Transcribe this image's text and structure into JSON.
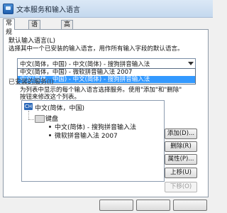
{
  "window": {
    "title": "文本服务和输入语言"
  },
  "tabs": [
    {
      "label": "常规",
      "active": true
    },
    {
      "label": "语言栏",
      "active": false
    },
    {
      "label": "高级键设置",
      "active": false
    }
  ],
  "default_language": {
    "heading": "默认输入语言(L)",
    "description": "选择其中一个已安装的输入语言，用作所有输入字段的默认语言。",
    "selected_value": "中文(简体，中国) - 中文(简体) - 搜狗拼音输入法",
    "options": [
      {
        "label": "中文(简体，中国) - 微软拼音输入法 2007",
        "selected": false
      },
      {
        "label": "中文(简体，中国) - 中文(简体) - 搜狗拼音输入法",
        "selected": true
      }
    ]
  },
  "installed_services": {
    "heading_partial": "已安装的服务(I)",
    "description_line1": "为列表中显示的每个输入语言选择服务。使用\"添加\"和\"删除\"",
    "description_line2": "按钮来修改这个列表。",
    "tree": {
      "language": "中文(简体，中国)",
      "language_icon_text": "CH",
      "group": "键盘",
      "items": [
        "中文(简体) - 搜狗拼音输入法",
        "微软拼音输入法 2007"
      ]
    }
  },
  "buttons": {
    "add": "添加(D)...",
    "remove": "删除(R)",
    "properties": "属性(P)...",
    "move_up": "上移(U)",
    "move_down": "下移(O)"
  },
  "colors": {
    "selection": "#3399ff"
  }
}
